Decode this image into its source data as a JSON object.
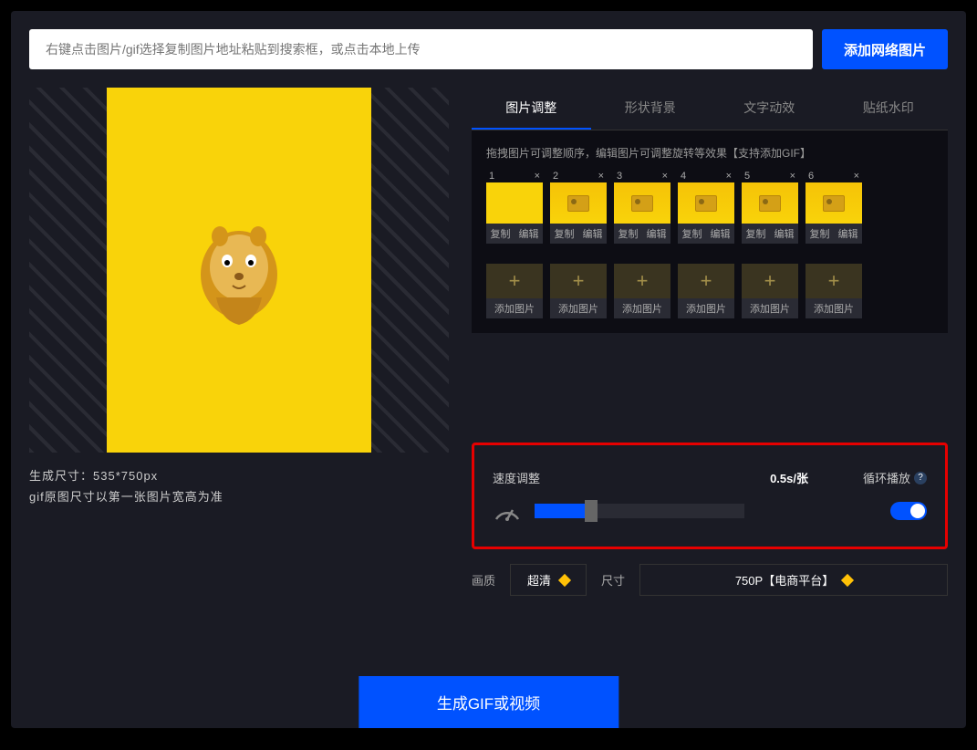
{
  "top": {
    "placeholder": "右键点击图片/gif选择复制图片地址粘贴到搜索框，或点击本地上传",
    "add_btn": "添加网络图片"
  },
  "preview": {
    "size_label": "生成尺寸：535*750px",
    "size_note": "gif原图尺寸以第一张图片宽高为准"
  },
  "tabs": [
    "图片调整",
    "形状背景",
    "文字动效",
    "贴纸水印"
  ],
  "panel": {
    "hint": "拖拽图片可调整顺序，编辑图片可调整旋转等效果【支持添加GIF】",
    "copy": "复制",
    "edit": "编辑",
    "add_label": "添加图片",
    "thumbs": [
      1,
      2,
      3,
      4,
      5,
      6
    ]
  },
  "speed": {
    "label": "速度调整",
    "value": "0.5s/张",
    "loop": "循环播放"
  },
  "quality": {
    "label": "画质",
    "value": "超清"
  },
  "size": {
    "label": "尺寸",
    "value": "750P【电商平台】"
  },
  "generate": "生成GIF或视频"
}
